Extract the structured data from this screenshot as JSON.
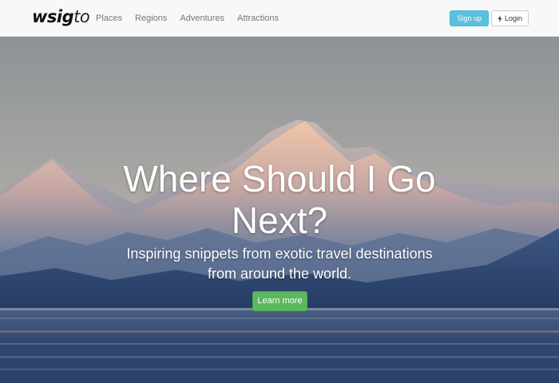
{
  "navbar": {
    "brand_bold": "wsig",
    "brand_light": "to",
    "links": [
      {
        "label": "Places"
      },
      {
        "label": "Regions"
      },
      {
        "label": "Adventures"
      },
      {
        "label": "Attractions"
      }
    ],
    "signup_label": "Sign up",
    "login_label": "Login",
    "login_icon": "bolt-icon"
  },
  "hero": {
    "title_line1": "Where Should I Go",
    "title_line2": "Next?",
    "subtitle_line1": "Inspiring snippets from exotic travel destinations",
    "subtitle_line2": "from around the world.",
    "cta_label": "Learn more"
  },
  "colors": {
    "navbar_bg": "#f8f8f8",
    "signup": "#5bc0de",
    "learn_more": "#5cb85c",
    "sky": "#9aa0a3",
    "mountain_glow": "#f0b08c",
    "lake": "#2d4d78"
  }
}
